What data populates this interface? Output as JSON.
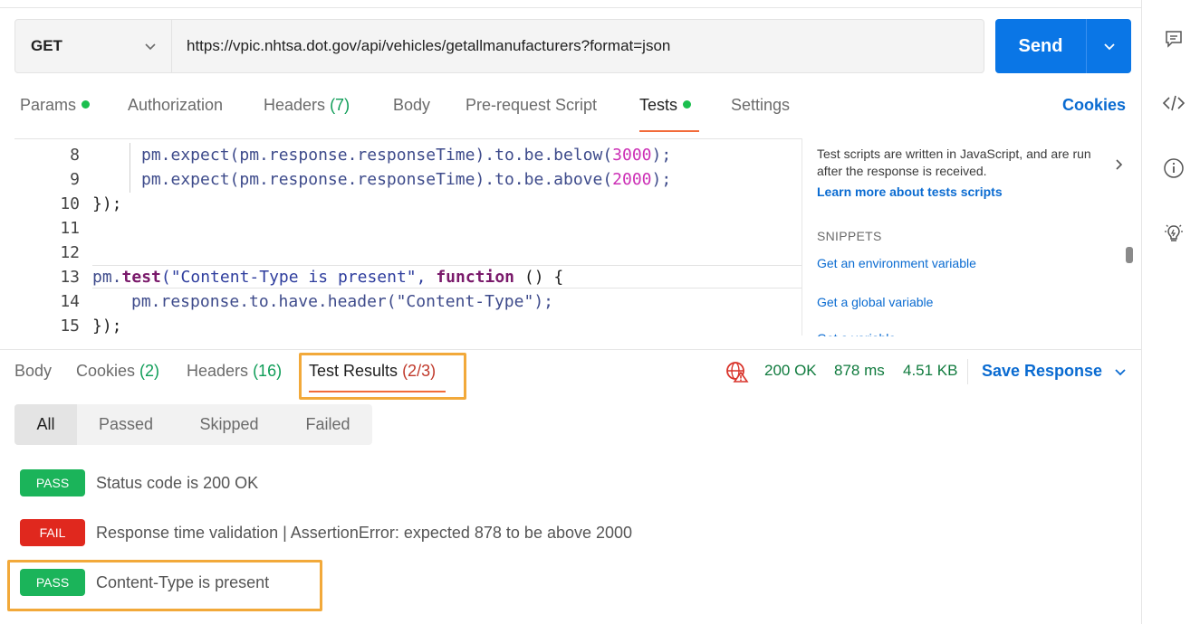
{
  "request": {
    "method": "GET",
    "url": "https://vpic.nhtsa.dot.gov/api/vehicles/getallmanufacturers?format=json",
    "send_label": "Send"
  },
  "request_tabs": [
    {
      "label": "Params",
      "indicator": "dot"
    },
    {
      "label": "Authorization"
    },
    {
      "label": "Headers",
      "count": "(7)"
    },
    {
      "label": "Body"
    },
    {
      "label": "Pre-request Script"
    },
    {
      "label": "Tests",
      "indicator": "dot",
      "active": true
    },
    {
      "label": "Settings"
    }
  ],
  "cookies_link": "Cookies",
  "editor": {
    "line_numbers": [
      "8",
      "9",
      "10",
      "11",
      "12",
      "13",
      "14",
      "15"
    ],
    "lines": {
      "l8": {
        "a": "pm.expect(pm.response.responseTime).to.be.below(",
        "n": "3000",
        "b": ");"
      },
      "l9": {
        "a": "pm.expect(pm.response.responseTime).to.be.above(",
        "n": "2000",
        "b": ");"
      },
      "l10": "});",
      "l13": {
        "a": "pm.",
        "k1": "test",
        "s": "(\"Content-Type is present\", ",
        "k2": "function",
        "b": " () {"
      },
      "l14": "pm.response.to.have.header(\"Content-Type\");",
      "l15": "});"
    }
  },
  "side_panel": {
    "description": "Test scripts are written in JavaScript, and are run after the response is received.",
    "learn_more": "Learn more about tests scripts",
    "snippets_heading": "SNIPPETS",
    "snippets": [
      "Get an environment variable",
      "Get a global variable",
      "Get a variable"
    ]
  },
  "response_tabs": [
    {
      "label": "Body"
    },
    {
      "label": "Cookies",
      "count": "(2)"
    },
    {
      "label": "Headers",
      "count": "(16)"
    },
    {
      "label": "Test Results",
      "count": "(2/3)",
      "active": true
    }
  ],
  "response_meta": {
    "status": "200 OK",
    "time": "878 ms",
    "size": "4.51 KB",
    "save_label": "Save Response"
  },
  "filters": [
    "All",
    "Passed",
    "Skipped",
    "Failed"
  ],
  "results": [
    {
      "status": "PASS",
      "text": "Status code is 200 OK"
    },
    {
      "status": "FAIL",
      "text": "Response time validation | AssertionError: expected 878 to be above 2000"
    },
    {
      "status": "PASS",
      "text": "Content-Type is present"
    }
  ],
  "colors": {
    "accent": "#0a76e6",
    "pass": "#1bb45a",
    "fail": "#e0281e",
    "highlight": "#f2a93a",
    "active_tab_underline": "#f26b3a"
  },
  "icons": [
    "comment-icon",
    "code-icon",
    "info-icon",
    "lightbulb-icon",
    "globe-warning-icon",
    "chevron-down-icon",
    "chevron-right-icon"
  ]
}
